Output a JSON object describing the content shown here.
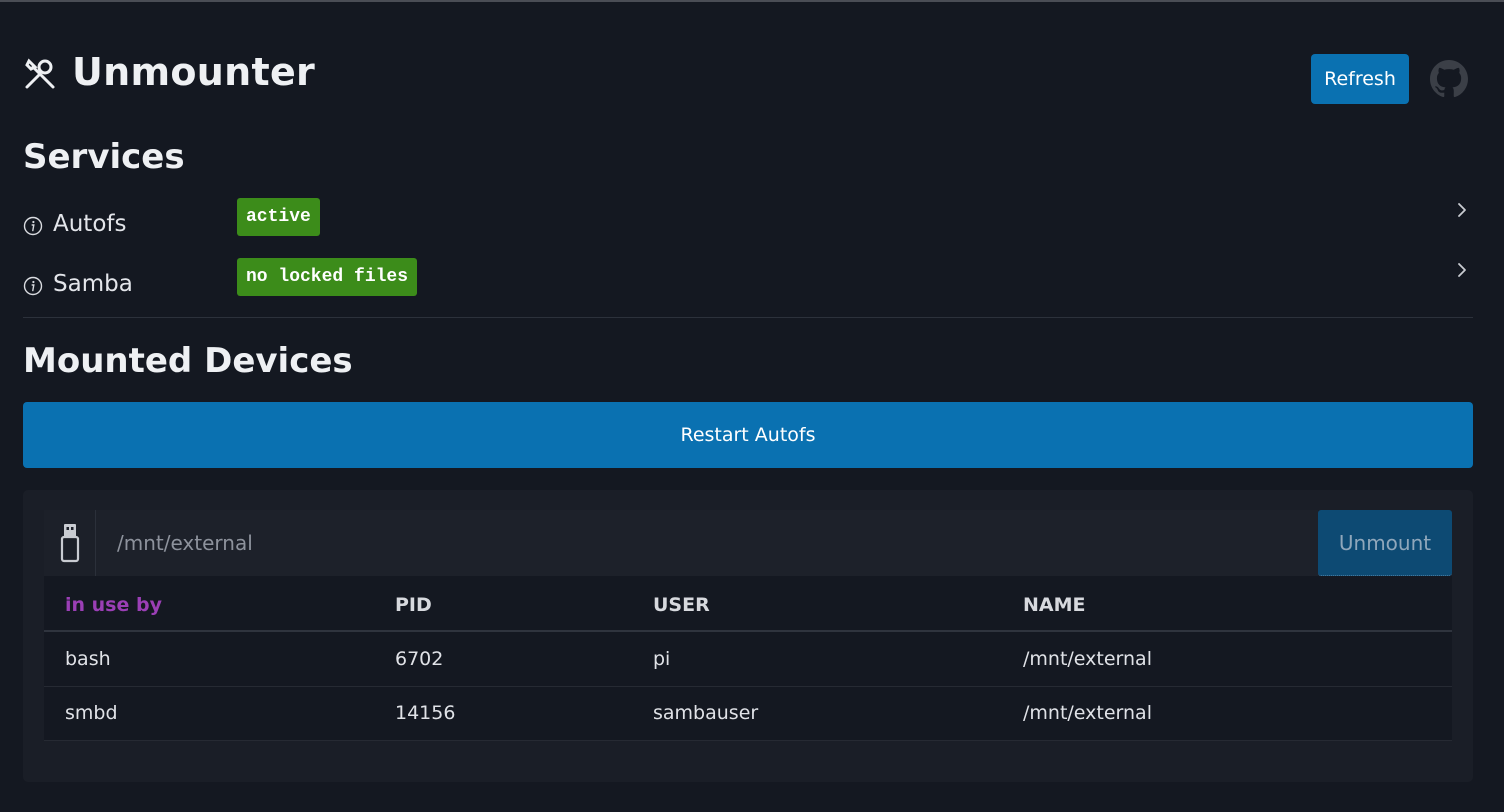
{
  "app": {
    "title": "Unmounter",
    "icon": "tools-icon"
  },
  "header": {
    "refresh_label": "Refresh",
    "github_icon": "github-icon"
  },
  "services": {
    "title": "Services",
    "items": [
      {
        "name": "Autofs",
        "status": "active",
        "status_color": "#3c8c1a"
      },
      {
        "name": "Samba",
        "status": "no locked files",
        "status_color": "#3c8c1a"
      }
    ]
  },
  "mounted": {
    "title": "Mounted Devices",
    "restart_label": "Restart Autofs",
    "device": {
      "icon": "usb-drive-icon",
      "path_placeholder": "/mnt/external",
      "unmount_label": "Unmount",
      "table": {
        "headers": [
          "in use by",
          "PID",
          "USER",
          "NAME"
        ],
        "rows": [
          [
            "bash",
            "6702",
            "pi",
            "/mnt/external"
          ],
          [
            "smbd",
            "14156",
            "sambauser",
            "/mnt/external"
          ]
        ]
      }
    }
  },
  "colors": {
    "accent": "#0a71b1",
    "background": "#141821",
    "in_use_header": "#9b3fb6"
  }
}
